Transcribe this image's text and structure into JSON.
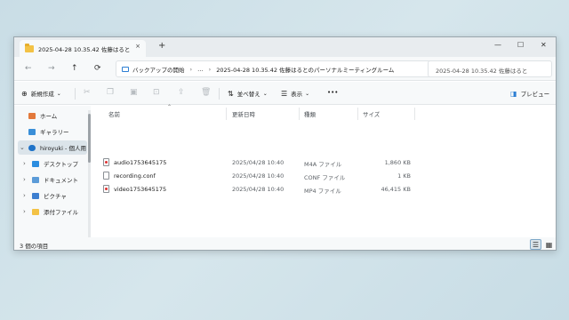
{
  "window": {
    "tab_title": "2025-04-28 10.35.42 佐藤はると",
    "tab_close": "×",
    "new_tab": "+",
    "controls": {
      "minimize": "—",
      "maximize": "☐",
      "close": "✕"
    }
  },
  "nav": {
    "back": "←",
    "forward": "→",
    "up": "↑",
    "refresh": "⟳",
    "breadcrumb": [
      "バックアップの開始",
      "…",
      "2025-04-28 10.35.42 佐藤はるとのパーソナルミーティングルーム"
    ],
    "search_text": "2025-04-28 10.35.42 佐藤はると"
  },
  "commands": {
    "new_label": "新規作成",
    "sort_label": "並べ替え",
    "view_label": "表示",
    "more_label": "•••",
    "preview_label": "プレビュー"
  },
  "sidebar": {
    "items": [
      {
        "label": "ホーム",
        "icon": "home-icon"
      },
      {
        "label": "ギャラリー",
        "icon": "gallery-icon"
      },
      {
        "label": "hiroyuki - 個人用",
        "icon": "cloud-icon"
      },
      {
        "label": "デスクトップ",
        "icon": "desktop-icon"
      },
      {
        "label": "ドキュメント",
        "icon": "document-icon"
      },
      {
        "label": "ピクチャ",
        "icon": "pictures-icon"
      },
      {
        "label": "添付ファイル",
        "icon": "folder-icon"
      }
    ]
  },
  "columns": {
    "name": "名前",
    "modified": "更新日時",
    "type": "種類",
    "size": "サイズ"
  },
  "files": [
    {
      "name": "audio1753645175",
      "modified": "2025/04/28 10:40",
      "type": "M4A ファイル",
      "size": "1,860 KB"
    },
    {
      "name": "recording.conf",
      "modified": "2025/04/28 10:40",
      "type": "CONF ファイル",
      "size": "1 KB"
    },
    {
      "name": "video1753645175",
      "modified": "2025/04/28 10:40",
      "type": "MP4 ファイル",
      "size": "46,415 KB"
    }
  ],
  "status": {
    "item_count": "3 個の項目"
  },
  "colors": {
    "accent": "#2d7fd3",
    "folder": "#f3c245",
    "selection": "#dbe4ea"
  }
}
